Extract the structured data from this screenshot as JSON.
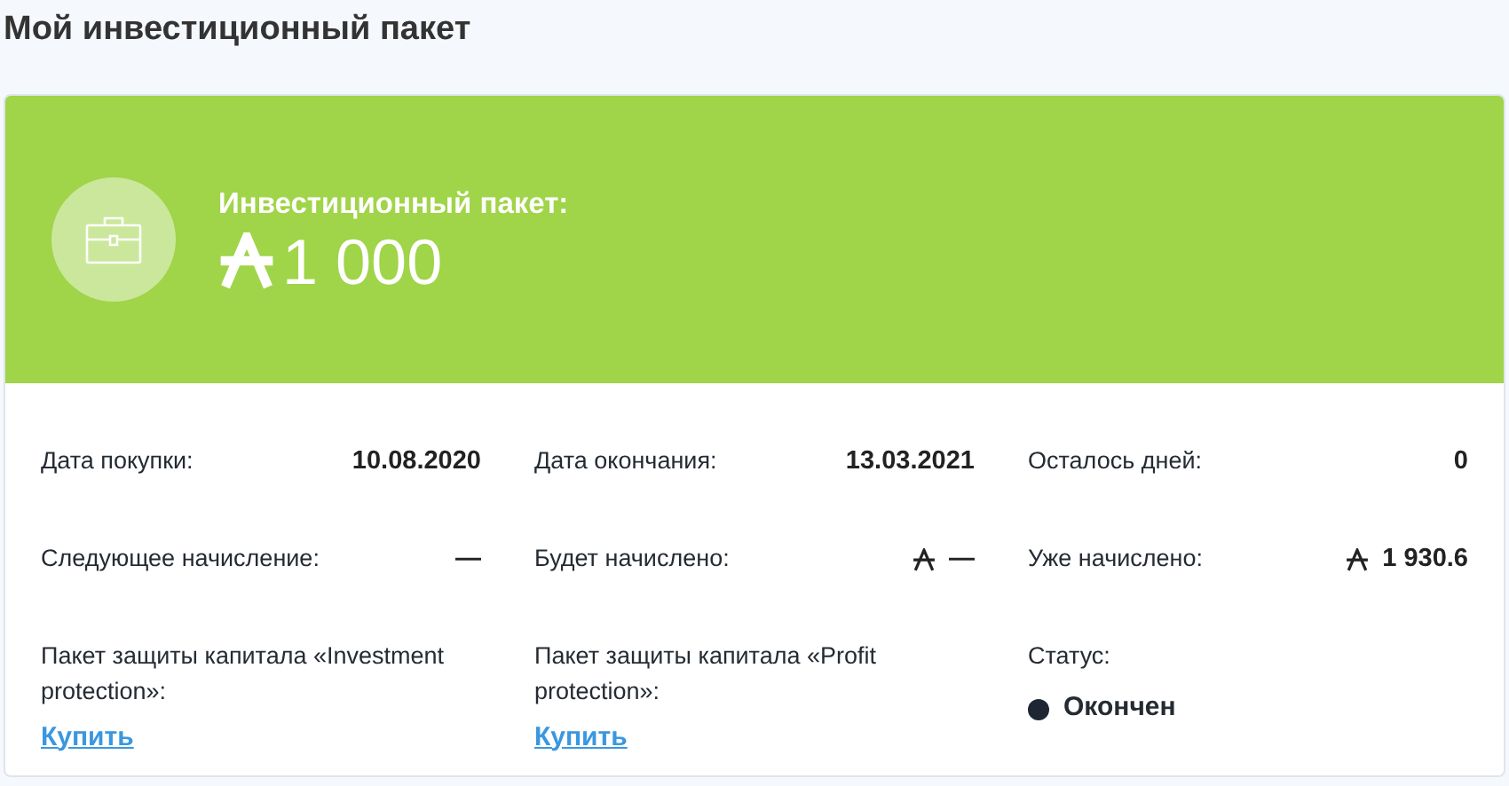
{
  "page_title": "Мой инвестиционный пакет",
  "package": {
    "label": "Инвестиционный пакет:",
    "amount": "1 000",
    "currency": true
  },
  "details": [
    {
      "kind": "value",
      "label": "Дата покупки:",
      "value": "10.08.2020",
      "currency": false
    },
    {
      "kind": "value",
      "label": "Дата окончания:",
      "value": "13.03.2021",
      "currency": false
    },
    {
      "kind": "value",
      "label": "Осталось дней:",
      "value": "0",
      "currency": false
    },
    {
      "kind": "value",
      "label": "Следующее начисление:",
      "value": "—",
      "currency": false
    },
    {
      "kind": "value",
      "label": "Будет начислено:",
      "value": "—",
      "currency": true
    },
    {
      "kind": "value",
      "label": "Уже начислено:",
      "value": "1 930.6",
      "currency": true
    },
    {
      "kind": "link",
      "label": "Пакет защиты капитала «Investment protection»:",
      "link": "Купить"
    },
    {
      "kind": "link",
      "label": "Пакет защиты капитала «Profit protection»:",
      "link": "Купить"
    },
    {
      "kind": "status",
      "label": "Статус:",
      "status": "Окончен",
      "color": "#1f2633"
    }
  ]
}
